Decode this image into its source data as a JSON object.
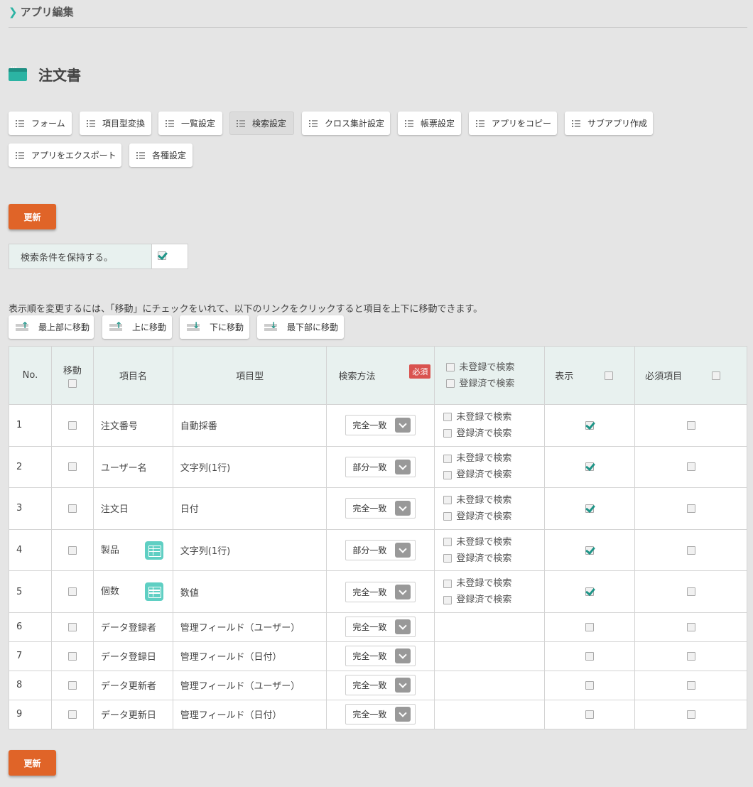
{
  "breadcrumb": {
    "label": "アプリ編集"
  },
  "page": {
    "title": "注文書"
  },
  "tabs": [
    {
      "label": "フォーム"
    },
    {
      "label": "項目型変換"
    },
    {
      "label": "一覧設定"
    },
    {
      "label": "検索設定",
      "active": true
    },
    {
      "label": "クロス集計設定"
    },
    {
      "label": "帳票設定"
    },
    {
      "label": "アプリをコピー"
    },
    {
      "label": "サブアプリ作成"
    },
    {
      "label": "アプリをエクスポート"
    },
    {
      "label": "各種設定"
    }
  ],
  "update_button": "更新",
  "keep_condition": {
    "label": "検索条件を保持する。",
    "checked": true
  },
  "instruction": "表示順を変更するには、「移動」にチェックをいれて、以下のリンクをクリックすると項目を上下に移動できます。",
  "move_buttons": [
    "最上部に移動",
    "上に移動",
    "下に移動",
    "最下部に移動"
  ],
  "table": {
    "headers": {
      "no": "No.",
      "move": "移動",
      "name": "項目名",
      "type": "項目型",
      "method": "検索方法",
      "required_badge": "必須",
      "unregistered": "未登録で検索",
      "registered": "登録済で検索",
      "display": "表示",
      "required": "必須項目"
    },
    "rows": [
      {
        "no": "1",
        "name": "注文番号",
        "type": "自動採番",
        "method": "完全一致",
        "reg_opts": true,
        "table_icon": false,
        "display": true
      },
      {
        "no": "2",
        "name": "ユーザー名",
        "type": "文字列(1行)",
        "method": "部分一致",
        "reg_opts": true,
        "table_icon": false,
        "display": true
      },
      {
        "no": "3",
        "name": "注文日",
        "type": "日付",
        "method": "完全一致",
        "reg_opts": true,
        "table_icon": false,
        "display": true
      },
      {
        "no": "4",
        "name": "製品",
        "type": "文字列(1行)",
        "method": "部分一致",
        "reg_opts": true,
        "table_icon": true,
        "display": true
      },
      {
        "no": "5",
        "name": "個数",
        "type": "数値",
        "method": "完全一致",
        "reg_opts": true,
        "table_icon": true,
        "display": true
      },
      {
        "no": "6",
        "name": "データ登録者",
        "type": "管理フィールド（ユーザー）",
        "method": "完全一致",
        "reg_opts": false,
        "table_icon": false,
        "display": false
      },
      {
        "no": "7",
        "name": "データ登録日",
        "type": "管理フィールド（日付）",
        "method": "完全一致",
        "reg_opts": false,
        "table_icon": false,
        "display": false
      },
      {
        "no": "8",
        "name": "データ更新者",
        "type": "管理フィールド（ユーザー）",
        "method": "完全一致",
        "reg_opts": false,
        "table_icon": false,
        "display": false
      },
      {
        "no": "9",
        "name": "データ更新日",
        "type": "管理フィールド（日付）",
        "method": "完全一致",
        "reg_opts": false,
        "table_icon": false,
        "display": false
      }
    ]
  },
  "colors": {
    "accent": "#2bb3a3",
    "update": "#e06428",
    "header_bg": "#e8f1ef",
    "required_badge": "#d9534f"
  }
}
